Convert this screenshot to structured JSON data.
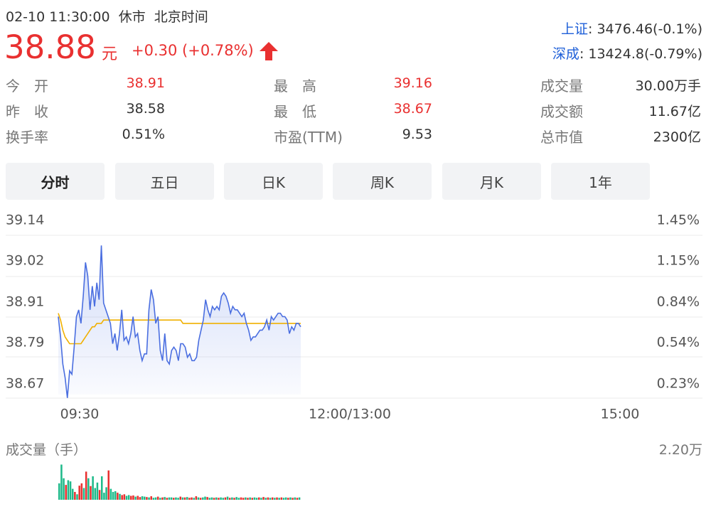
{
  "header": {
    "datetime": "02-10 11:30:00",
    "status": "休市",
    "timezone": "北京时间",
    "price": "38.88",
    "unit": "元",
    "change": "+0.30 (+0.78%)",
    "up_color": "#e93030"
  },
  "indices": [
    {
      "name": "上证",
      "value": ": 3476.46(-0.1%)"
    },
    {
      "name": "深成",
      "value": ": 13424.8(-0.79%)"
    }
  ],
  "stats": [
    {
      "label": "今　开",
      "value": "38.91",
      "highlight": true
    },
    {
      "label": "最　高",
      "value": "39.16",
      "highlight": true
    },
    {
      "label": "成交量",
      "value": "30.00万手",
      "highlight": false
    },
    {
      "label": "昨　收",
      "value": "38.58",
      "highlight": false
    },
    {
      "label": "最　低",
      "value": "38.67",
      "highlight": true
    },
    {
      "label": "成交额",
      "value": "11.67亿",
      "highlight": false
    },
    {
      "label": "换手率",
      "value": "0.51%",
      "highlight": false
    },
    {
      "label": "市盈(TTM)",
      "value": "9.53",
      "highlight": false
    },
    {
      "label": "总市值",
      "value": "2300亿",
      "highlight": false
    }
  ],
  "tabs": [
    {
      "label": "分时",
      "active": true
    },
    {
      "label": "五日",
      "active": false
    },
    {
      "label": "日K",
      "active": false
    },
    {
      "label": "周K",
      "active": false
    },
    {
      "label": "月K",
      "active": false
    },
    {
      "label": "1年",
      "active": false
    }
  ],
  "volume": {
    "label": "成交量（手）",
    "max_label": "2.20万"
  },
  "chart_data": {
    "type": "line",
    "y_ticks": [
      "39.14",
      "39.02",
      "38.91",
      "38.79",
      "38.67"
    ],
    "y_pct_ticks": [
      "1.45%",
      "1.15%",
      "0.84%",
      "0.54%",
      "0.23%"
    ],
    "ylim": [
      38.67,
      39.14
    ],
    "x_ticks": [
      "09:30",
      "12:00/13:00",
      "15:00"
    ],
    "x_total_minutes": 240,
    "series": [
      {
        "role": "price",
        "color": "#4a6ee0",
        "values": [
          38.9,
          38.84,
          38.76,
          38.72,
          38.66,
          38.74,
          38.73,
          38.81,
          38.9,
          38.92,
          38.88,
          38.96,
          39.06,
          39.02,
          38.92,
          38.99,
          38.93,
          39.0,
          38.95,
          39.11,
          38.94,
          38.92,
          38.9,
          38.88,
          38.82,
          38.85,
          38.8,
          38.85,
          38.92,
          38.83,
          38.84,
          38.82,
          38.85,
          38.9,
          38.84,
          38.85,
          38.8,
          38.77,
          38.79,
          38.79,
          38.92,
          38.98,
          38.95,
          38.88,
          38.9,
          38.8,
          38.77,
          38.85,
          38.77,
          38.76,
          38.8,
          38.81,
          38.8,
          38.77,
          38.82,
          38.82,
          38.81,
          38.78,
          38.79,
          38.77,
          38.77,
          38.78,
          38.83,
          38.86,
          38.89,
          38.95,
          38.92,
          38.9,
          38.93,
          38.92,
          38.93,
          38.92,
          38.96,
          38.97,
          38.96,
          38.94,
          38.91,
          38.93,
          38.92,
          38.92,
          38.91,
          38.9,
          38.91,
          38.88,
          38.86,
          38.83,
          38.84,
          38.84,
          38.85,
          38.86,
          38.86,
          38.87,
          38.89,
          38.86,
          38.9,
          38.89,
          38.9,
          38.91,
          38.91,
          38.9,
          38.9,
          38.89,
          38.85,
          38.87,
          38.86,
          38.88,
          38.88,
          38.87
        ]
      },
      {
        "role": "average",
        "color": "#f0b000",
        "values": [
          38.91,
          38.89,
          38.86,
          38.84,
          38.83,
          38.82,
          38.82,
          38.82,
          38.82,
          38.82,
          38.82,
          38.83,
          38.84,
          38.85,
          38.86,
          38.87,
          38.87,
          38.88,
          38.88,
          38.88,
          38.89,
          38.89,
          38.89,
          38.89,
          38.89,
          38.89,
          38.89,
          38.89,
          38.89,
          38.89,
          38.89,
          38.89,
          38.89,
          38.89,
          38.89,
          38.89,
          38.89,
          38.89,
          38.89,
          38.89,
          38.89,
          38.89,
          38.89,
          38.89,
          38.89,
          38.89,
          38.89,
          38.89,
          38.89,
          38.89,
          38.89,
          38.89,
          38.89,
          38.89,
          38.89,
          38.88,
          38.88,
          38.88,
          38.88,
          38.88,
          38.88,
          38.88,
          38.88,
          38.88,
          38.88,
          38.88,
          38.88,
          38.88,
          38.88,
          38.88,
          38.88,
          38.88,
          38.88,
          38.88,
          38.88,
          38.88,
          38.88,
          38.88,
          38.88,
          38.88,
          38.88,
          38.88,
          38.88,
          38.88,
          38.88,
          38.88,
          38.88,
          38.88,
          38.88,
          38.88,
          38.88,
          38.88,
          38.88,
          38.88,
          38.88,
          38.88,
          38.88,
          38.88,
          38.88,
          38.88,
          38.88,
          38.88,
          38.88,
          38.88,
          38.88,
          38.88,
          38.88,
          38.88
        ]
      }
    ],
    "volume_bars": [
      {
        "v": 0.42,
        "up": true
      },
      {
        "v": 0.9,
        "up": true
      },
      {
        "v": 0.55,
        "up": true
      },
      {
        "v": 0.38,
        "up": false
      },
      {
        "v": 0.5,
        "up": true
      },
      {
        "v": 0.47,
        "up": true
      },
      {
        "v": 0.28,
        "up": true
      },
      {
        "v": 0.2,
        "up": false
      },
      {
        "v": 0.14,
        "up": true
      },
      {
        "v": 0.36,
        "up": false
      },
      {
        "v": 0.42,
        "up": false
      },
      {
        "v": 0.3,
        "up": true
      },
      {
        "v": 0.72,
        "up": false
      },
      {
        "v": 0.55,
        "up": true
      },
      {
        "v": 0.35,
        "up": false
      },
      {
        "v": 0.6,
        "up": true
      },
      {
        "v": 0.3,
        "up": true
      },
      {
        "v": 0.44,
        "up": true
      },
      {
        "v": 0.25,
        "up": false
      },
      {
        "v": 0.6,
        "up": true
      },
      {
        "v": 0.18,
        "up": true
      },
      {
        "v": 0.32,
        "up": true
      },
      {
        "v": 0.75,
        "up": false
      },
      {
        "v": 0.28,
        "up": true
      },
      {
        "v": 0.2,
        "up": true
      },
      {
        "v": 0.22,
        "up": true
      },
      {
        "v": 0.18,
        "up": false
      },
      {
        "v": 0.15,
        "up": true
      },
      {
        "v": 0.12,
        "up": false
      },
      {
        "v": 0.14,
        "up": false
      },
      {
        "v": 0.1,
        "up": true
      },
      {
        "v": 0.12,
        "up": true
      },
      {
        "v": 0.1,
        "up": false
      },
      {
        "v": 0.11,
        "up": false
      },
      {
        "v": 0.08,
        "up": true
      },
      {
        "v": 0.1,
        "up": false
      },
      {
        "v": 0.07,
        "up": false
      },
      {
        "v": 0.09,
        "up": true
      },
      {
        "v": 0.08,
        "up": true
      },
      {
        "v": 0.07,
        "up": false
      },
      {
        "v": 0.06,
        "up": true
      },
      {
        "v": 0.09,
        "up": false
      },
      {
        "v": 0.05,
        "up": true
      },
      {
        "v": 0.06,
        "up": true
      },
      {
        "v": 0.08,
        "up": false
      },
      {
        "v": 0.05,
        "up": true
      },
      {
        "v": 0.06,
        "up": false
      },
      {
        "v": 0.07,
        "up": true
      },
      {
        "v": 0.05,
        "up": false
      },
      {
        "v": 0.06,
        "up": true
      },
      {
        "v": 0.06,
        "up": true
      },
      {
        "v": 0.05,
        "up": false
      },
      {
        "v": 0.06,
        "up": true
      },
      {
        "v": 0.05,
        "up": true
      },
      {
        "v": 0.08,
        "up": false
      },
      {
        "v": 0.06,
        "up": true
      },
      {
        "v": 0.06,
        "up": false
      },
      {
        "v": 0.07,
        "up": true
      },
      {
        "v": 0.05,
        "up": false
      },
      {
        "v": 0.06,
        "up": false
      },
      {
        "v": 0.05,
        "up": true
      },
      {
        "v": 0.09,
        "up": false
      },
      {
        "v": 0.06,
        "up": true
      },
      {
        "v": 0.05,
        "up": false
      },
      {
        "v": 0.06,
        "up": true
      },
      {
        "v": 0.08,
        "up": true
      },
      {
        "v": 0.07,
        "up": false
      },
      {
        "v": 0.05,
        "up": true
      },
      {
        "v": 0.06,
        "up": true
      },
      {
        "v": 0.05,
        "up": false
      },
      {
        "v": 0.06,
        "up": true
      },
      {
        "v": 0.05,
        "up": false
      },
      {
        "v": 0.06,
        "up": true
      },
      {
        "v": 0.05,
        "up": true
      },
      {
        "v": 0.06,
        "up": false
      },
      {
        "v": 0.08,
        "up": true
      },
      {
        "v": 0.05,
        "up": false
      },
      {
        "v": 0.06,
        "up": true
      },
      {
        "v": 0.05,
        "up": false
      },
      {
        "v": 0.07,
        "up": true
      },
      {
        "v": 0.05,
        "up": true
      },
      {
        "v": 0.06,
        "up": false
      },
      {
        "v": 0.05,
        "up": false
      },
      {
        "v": 0.06,
        "up": true
      },
      {
        "v": 0.05,
        "up": false
      },
      {
        "v": 0.06,
        "up": true
      },
      {
        "v": 0.05,
        "up": false
      },
      {
        "v": 0.06,
        "up": true
      },
      {
        "v": 0.05,
        "up": true
      },
      {
        "v": 0.06,
        "up": false
      },
      {
        "v": 0.05,
        "up": true
      },
      {
        "v": 0.07,
        "up": false
      },
      {
        "v": 0.05,
        "up": true
      },
      {
        "v": 0.06,
        "up": false
      },
      {
        "v": 0.05,
        "up": true
      },
      {
        "v": 0.06,
        "up": false
      },
      {
        "v": 0.05,
        "up": true
      },
      {
        "v": 0.06,
        "up": false
      },
      {
        "v": 0.05,
        "up": true
      },
      {
        "v": 0.06,
        "up": false
      },
      {
        "v": 0.05,
        "up": true
      },
      {
        "v": 0.06,
        "up": true
      },
      {
        "v": 0.05,
        "up": false
      },
      {
        "v": 0.06,
        "up": true
      },
      {
        "v": 0.05,
        "up": false
      },
      {
        "v": 0.06,
        "up": true
      },
      {
        "v": 0.05,
        "up": false
      },
      {
        "v": 0.06,
        "up": true
      }
    ]
  }
}
